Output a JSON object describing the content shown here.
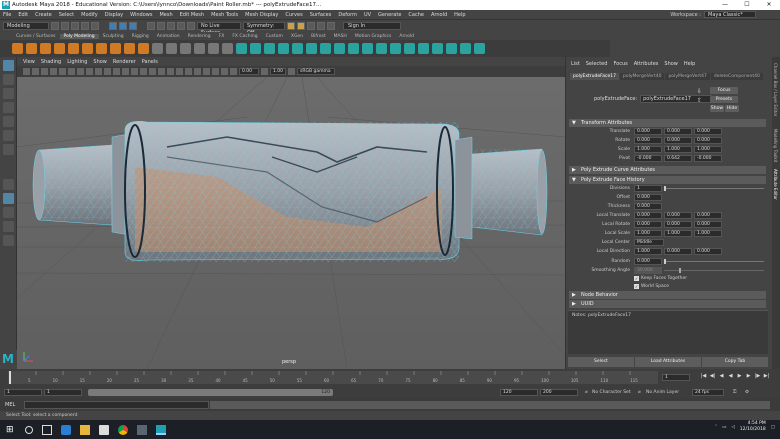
{
  "window": {
    "title": "Autodesk Maya 2018 - Educational Version: C:\\Users\\lynnco\\Downloads\\Paint Roller.mb* --- polyExtrudeFace17...",
    "controls": [
      "—",
      "☐",
      "✕"
    ]
  },
  "menubar": {
    "items": [
      "File",
      "Edit",
      "Create",
      "Select",
      "Modify",
      "Display",
      "Windows",
      "Mesh",
      "Edit Mesh",
      "Mesh Tools",
      "Mesh Display",
      "Curves",
      "Surfaces",
      "Deform",
      "UV",
      "Generate",
      "Cache",
      "Arnold",
      "Help"
    ],
    "workspace_label": "Workspace :",
    "workspace_value": "Maya Classic*"
  },
  "statusline": {
    "mode": "Modeling",
    "live_surface": "No Live Surface",
    "symmetry": "Symmetry: Off",
    "signin": "Sign In"
  },
  "shelf": {
    "tabs": [
      "Curves / Surfaces",
      "Poly Modeling",
      "Sculpting",
      "Rigging",
      "Animation",
      "Rendering",
      "FX",
      "FX Caching",
      "Custom",
      "XGen",
      "Bifrost",
      "MASH",
      "Motion Graphics",
      "Arnold"
    ],
    "active_tab": "Poly Modeling"
  },
  "viewport": {
    "menu": [
      "View",
      "Shading",
      "Lighting",
      "Show",
      "Renderer",
      "Panels"
    ],
    "exposure": "0.00",
    "gamma": "1.00",
    "color_space": "sRGB gamma",
    "camera": "persp"
  },
  "attribute_editor": {
    "menu": [
      "List",
      "Selected",
      "Focus",
      "Attributes",
      "Show",
      "Help"
    ],
    "tabs": [
      "polyExtrudeFace17",
      "polyMergeVert40",
      "polyMergeVert47",
      "deleteComponent40"
    ],
    "node_label": "polyExtrudeFace:",
    "node_value": "polyExtrudeFace17",
    "buttons": {
      "focus": "Focus",
      "presets": "Presets",
      "show": "Show",
      "hide": "Hide"
    },
    "sections": {
      "transform": "Transform Attributes",
      "curve": "Poly Extrude Curve Attributes",
      "face_history": "Poly Extrude Face History",
      "node_behavior": "Node Behavior",
      "uuid": "UUID"
    },
    "transform": {
      "rows": [
        {
          "label": "Translate",
          "values": [
            "0.000",
            "0.000",
            "0.000"
          ]
        },
        {
          "label": "Rotate",
          "values": [
            "0.000",
            "0.000",
            "0.000"
          ]
        },
        {
          "label": "Scale",
          "values": [
            "1.000",
            "1.000",
            "1.000"
          ]
        },
        {
          "label": "Pivot",
          "values": [
            "-0.000",
            "0.642",
            "-0.000"
          ]
        }
      ]
    },
    "history": {
      "divisions_label": "Divisions",
      "divisions": "1",
      "offset_label": "Offset",
      "offset": "0.000",
      "thickness_label": "Thickness",
      "thickness": "0.000",
      "rows": [
        {
          "label": "Local Translate",
          "values": [
            "0.000",
            "0.000",
            "0.000"
          ]
        },
        {
          "label": "Local Rotate",
          "values": [
            "0.000",
            "0.000",
            "0.000"
          ]
        },
        {
          "label": "Local Scale",
          "values": [
            "1.000",
            "1.000",
            "1.000"
          ]
        }
      ],
      "local_center_label": "Local Center",
      "local_center": "Middle",
      "local_direction_label": "Local Direction",
      "local_direction": [
        "1.000",
        "0.000",
        "0.000"
      ],
      "random_label": "Random",
      "random": "0.000",
      "smoothing_label": "Smoothing Angle",
      "smoothing": "30.000",
      "keep_faces": "Keep Faces Together",
      "world_space": "World Space"
    },
    "notes_label": "Notes:  polyExtrudeFace17",
    "bottom_buttons": [
      "Select",
      "Load Attributes",
      "Copy Tab"
    ]
  },
  "right_strip": [
    "Channel Box / Layer Editor",
    "Modelling Toolkit",
    "Attribute Editor"
  ],
  "timeslider": {
    "ticks": [
      "5",
      "10",
      "15",
      "20",
      "25",
      "30",
      "35",
      "40",
      "45",
      "50",
      "55",
      "60",
      "65",
      "70",
      "75",
      "80",
      "85",
      "90",
      "95",
      "100",
      "105",
      "110",
      "115",
      "1"
    ],
    "current_frame": "1",
    "playback": [
      "|◀",
      "◀|",
      "◀",
      "◀",
      "▶",
      "▶",
      "|▶",
      "▶|"
    ]
  },
  "rangeslider": {
    "start": "1",
    "start2": "1",
    "range_end": "120",
    "end": "120",
    "end2": "200",
    "character_set": "No Character Set",
    "anim_layer": "No Anim Layer",
    "fps": "24 fps"
  },
  "cmdline": {
    "label": "MEL"
  },
  "helpline": {
    "text": "Select Tool: select a component"
  },
  "taskbar": {
    "time": "4:54 PM",
    "date": "12/10/2018"
  },
  "colors": {
    "accent_teal": "#2ab3c4",
    "shelf_orange": "#d07a24",
    "wire_cyan": "#6ad8ee",
    "mesh_fill": "#9aa0a8",
    "selected_faces": "#c8906a"
  }
}
